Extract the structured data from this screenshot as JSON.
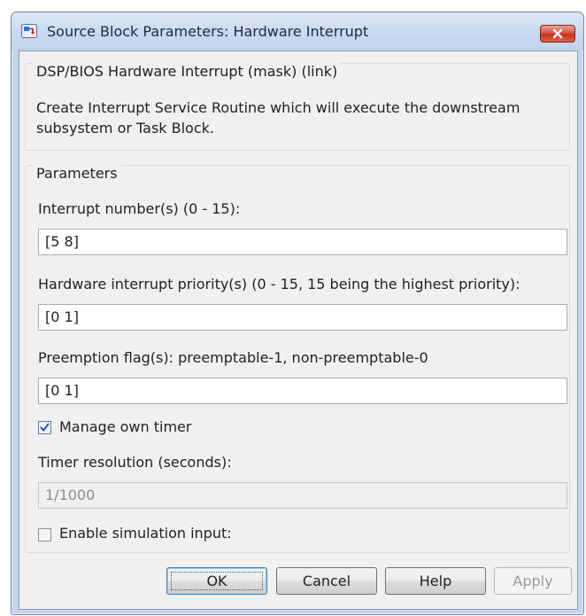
{
  "window": {
    "title": "Source Block Parameters: Hardware Interrupt"
  },
  "mask": {
    "header": "DSP/BIOS Hardware Interrupt (mask) (link)",
    "description": "Create Interrupt Service Routine which will execute the downstream subsystem or Task Block."
  },
  "parameters": {
    "group_title": "Parameters",
    "interrupt_numbers": {
      "label": "Interrupt number(s) (0 - 15):",
      "value": "[5 8]"
    },
    "hw_priority": {
      "label": "Hardware interrupt priority(s) (0 - 15, 15 being the highest priority):",
      "value": "[0 1]"
    },
    "preemption": {
      "label": "Preemption flag(s): preemptable-1, non-preemptable-0",
      "value": "[0 1]"
    },
    "manage_timer": {
      "label": "Manage own timer",
      "checked": true
    },
    "timer_resolution": {
      "label": "Timer resolution (seconds):",
      "value": "1/1000",
      "enabled": false
    },
    "enable_sim_input": {
      "label": "Enable simulation input:",
      "checked": false
    }
  },
  "buttons": {
    "ok": "OK",
    "cancel": "Cancel",
    "help": "Help",
    "apply": "Apply"
  },
  "icons": {
    "app": "simulink-block-icon",
    "close": "close-icon",
    "check": "checkmark-icon"
  },
  "colors": {
    "title_bar": "#c6d6ea",
    "close_button": "#d6553f",
    "dialog_bg": "#f0f0f0",
    "checkbox_accent": "#2a5aa8"
  }
}
